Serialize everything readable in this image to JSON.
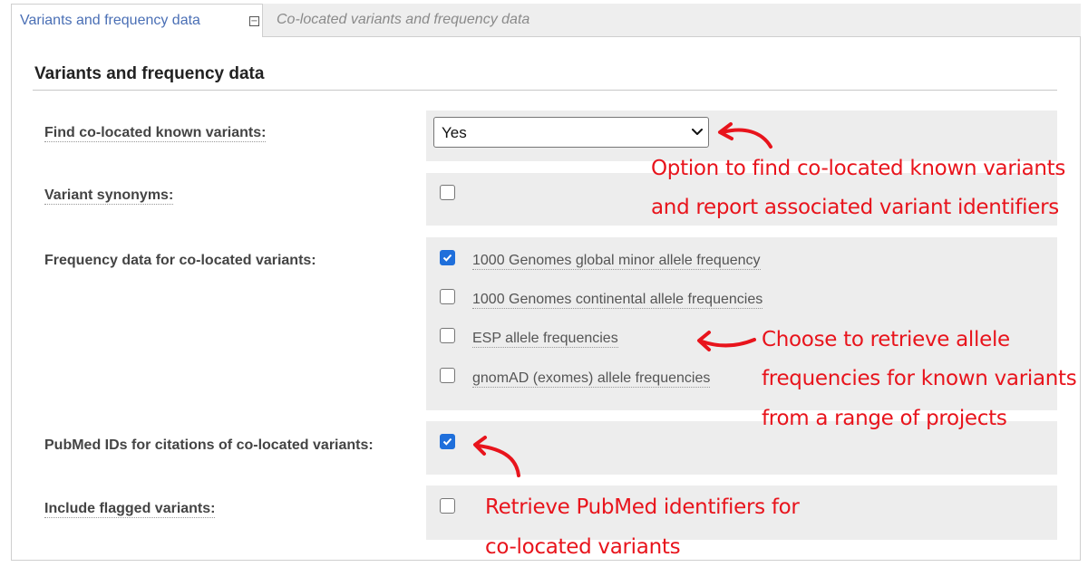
{
  "tabs": {
    "active_label": "Variants and frequency data",
    "collapse_symbol": "−",
    "inactive_label": "Co-located variants and frequency data"
  },
  "section": {
    "title": "Variants and frequency data"
  },
  "rows": {
    "colocated": {
      "label": "Find co-located known variants:",
      "select_value": "Yes"
    },
    "synonyms": {
      "label": "Variant synonyms:",
      "checked": false
    },
    "frequency": {
      "label": "Frequency data for co-located variants:",
      "options": [
        {
          "label": "1000 Genomes global minor allele frequency",
          "checked": true
        },
        {
          "label": "1000 Genomes continental allele frequencies",
          "checked": false
        },
        {
          "label": "ESP allele frequencies",
          "checked": false
        },
        {
          "label": "gnomAD (exomes) allele frequencies",
          "checked": false
        }
      ]
    },
    "pubmed": {
      "label": "PubMed IDs for citations of co-located variants:",
      "checked": true
    },
    "flagged": {
      "label": "Include flagged variants:",
      "checked": false
    }
  },
  "annotations": {
    "colocated": [
      "Option to find co-located known variants",
      "and report associated variant identifiers"
    ],
    "frequencies": [
      "Choose to retrieve allele",
      "frequencies for known variants",
      "from a range of projects"
    ],
    "pubmed": [
      "Retrieve PubMed identifiers for",
      "co-located variants"
    ]
  },
  "colors": {
    "annotation": "#e8141c",
    "checkbox_checked": "#1f6fdb",
    "tab_active_text": "#4a6fb5"
  },
  "icons": {
    "collapse": "minus-box-icon",
    "select_chevron": "chevron-down-icon",
    "checkmark": "checkmark-icon",
    "annotation_arrow": "curved-arrow-icon"
  }
}
